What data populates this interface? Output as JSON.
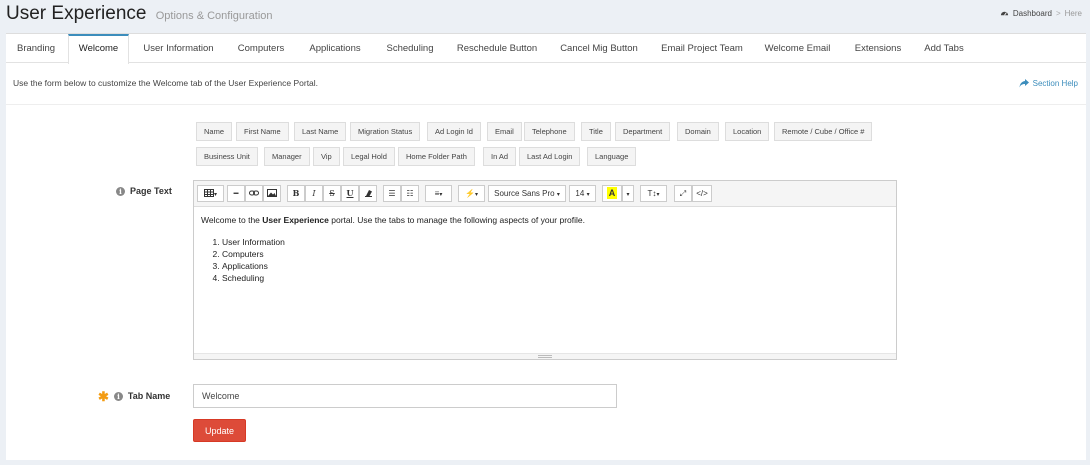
{
  "header": {
    "title": "User Experience",
    "subtitle": "Options & Configuration",
    "breadcrumb": {
      "home_icon": "dashboard-icon",
      "home": "Dashboard",
      "separator": ">",
      "current": "Here"
    }
  },
  "tabs": [
    {
      "label": "Branding",
      "active": false
    },
    {
      "label": "Welcome",
      "active": true
    },
    {
      "label": "User Information",
      "active": false
    },
    {
      "label": "Computers",
      "active": false
    },
    {
      "label": "Applications",
      "active": false
    },
    {
      "label": "Scheduling",
      "active": false
    },
    {
      "label": "Reschedule Button",
      "active": false
    },
    {
      "label": "Cancel Mig Button",
      "active": false
    },
    {
      "label": "Email Project Team",
      "active": false
    },
    {
      "label": "Welcome Email",
      "active": false
    },
    {
      "label": "Extensions",
      "active": false
    },
    {
      "label": "Add Tabs",
      "active": false
    }
  ],
  "intro": "Use the form below to customize the Welcome tab of the User Experience Portal.",
  "section_help": {
    "label": "Section Help",
    "icon": "share-arrow-icon"
  },
  "placeholders": [
    "Name",
    "First Name",
    "Last Name",
    "Migration Status",
    "Ad Login Id",
    "Email",
    "Telephone",
    "Title",
    "Department",
    "Domain",
    "Location",
    "Remote / Cube / Office #",
    "Business Unit",
    "Manager",
    "Vip",
    "Legal Hold",
    "Home Folder Path",
    "In Ad",
    "Last Ad Login",
    "Language"
  ],
  "page_text": {
    "label": "Page Text",
    "toolbar": {
      "font_name": "Source Sans Pro",
      "font_size": "14",
      "highlight_letter": "A",
      "code_view": "</>"
    },
    "content": {
      "intro_before": "Welcome to the ",
      "intro_bold": "User Experience",
      "intro_after": " portal. Use the tabs to manage the following aspects of your profile.",
      "items": [
        "User Information",
        "Computers",
        "Applications",
        "Scheduling"
      ]
    }
  },
  "tab_name": {
    "label": "Tab Name",
    "value": "Welcome",
    "required": true
  },
  "update_button": "Update",
  "colors": {
    "accent": "#3c8dbc",
    "danger": "#dd4b39",
    "required": "#f39c12",
    "background": "#ecf0f5"
  }
}
